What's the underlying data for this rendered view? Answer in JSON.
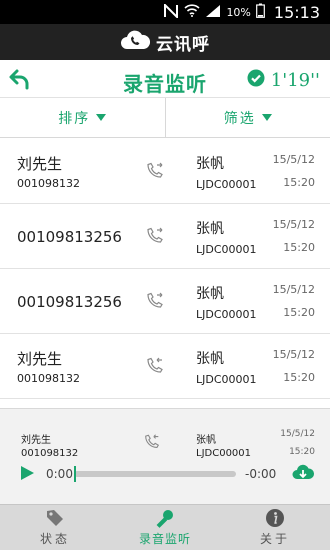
{
  "status_bar": {
    "battery": "10%",
    "time": "15:13",
    "icons": [
      "n-icon",
      "wifi-icon",
      "signal-icon",
      "battery-icon"
    ]
  },
  "app": {
    "name": "云讯呼"
  },
  "titlebar": {
    "title": "录音监听",
    "timer": "1'19''"
  },
  "filters": {
    "sort_label": "排序",
    "filter_label": "筛选"
  },
  "records": [
    {
      "caller_name": "刘先生",
      "caller_number": "001098132",
      "direction": "outgoing",
      "agent_name": "张帆",
      "agent_id": "LJDC00001",
      "date": "15/5/12",
      "time": "15:20"
    },
    {
      "caller_name": "",
      "caller_number": "00109813256",
      "direction": "outgoing",
      "agent_name": "张帆",
      "agent_id": "LJDC00001",
      "date": "15/5/12",
      "time": "15:20"
    },
    {
      "caller_name": "",
      "caller_number": "00109813256",
      "direction": "outgoing",
      "agent_name": "张帆",
      "agent_id": "LJDC00001",
      "date": "15/5/12",
      "time": "15:20"
    },
    {
      "caller_name": "刘先生",
      "caller_number": "001098132",
      "direction": "incoming",
      "agent_name": "张帆",
      "agent_id": "LJDC00001",
      "date": "15/5/12",
      "time": "15:20"
    }
  ],
  "player": {
    "caller_name": "刘先生",
    "caller_number": "001098132",
    "agent_name": "张帆",
    "agent_id": "LJDC00001",
    "date": "15/5/12",
    "time": "15:20",
    "elapsed": "0:00",
    "remaining": "-0:00",
    "progress": 0
  },
  "tabs": [
    {
      "label": "状态",
      "icon": "tag-icon",
      "active": false
    },
    {
      "label": "录音监听",
      "icon": "microphone-icon",
      "active": true
    },
    {
      "label": "关于",
      "icon": "info-icon",
      "active": false
    }
  ],
  "colors": {
    "accent": "#1aa56e",
    "dark_bar": "#222222",
    "tab_bg": "#d9d9d9"
  }
}
